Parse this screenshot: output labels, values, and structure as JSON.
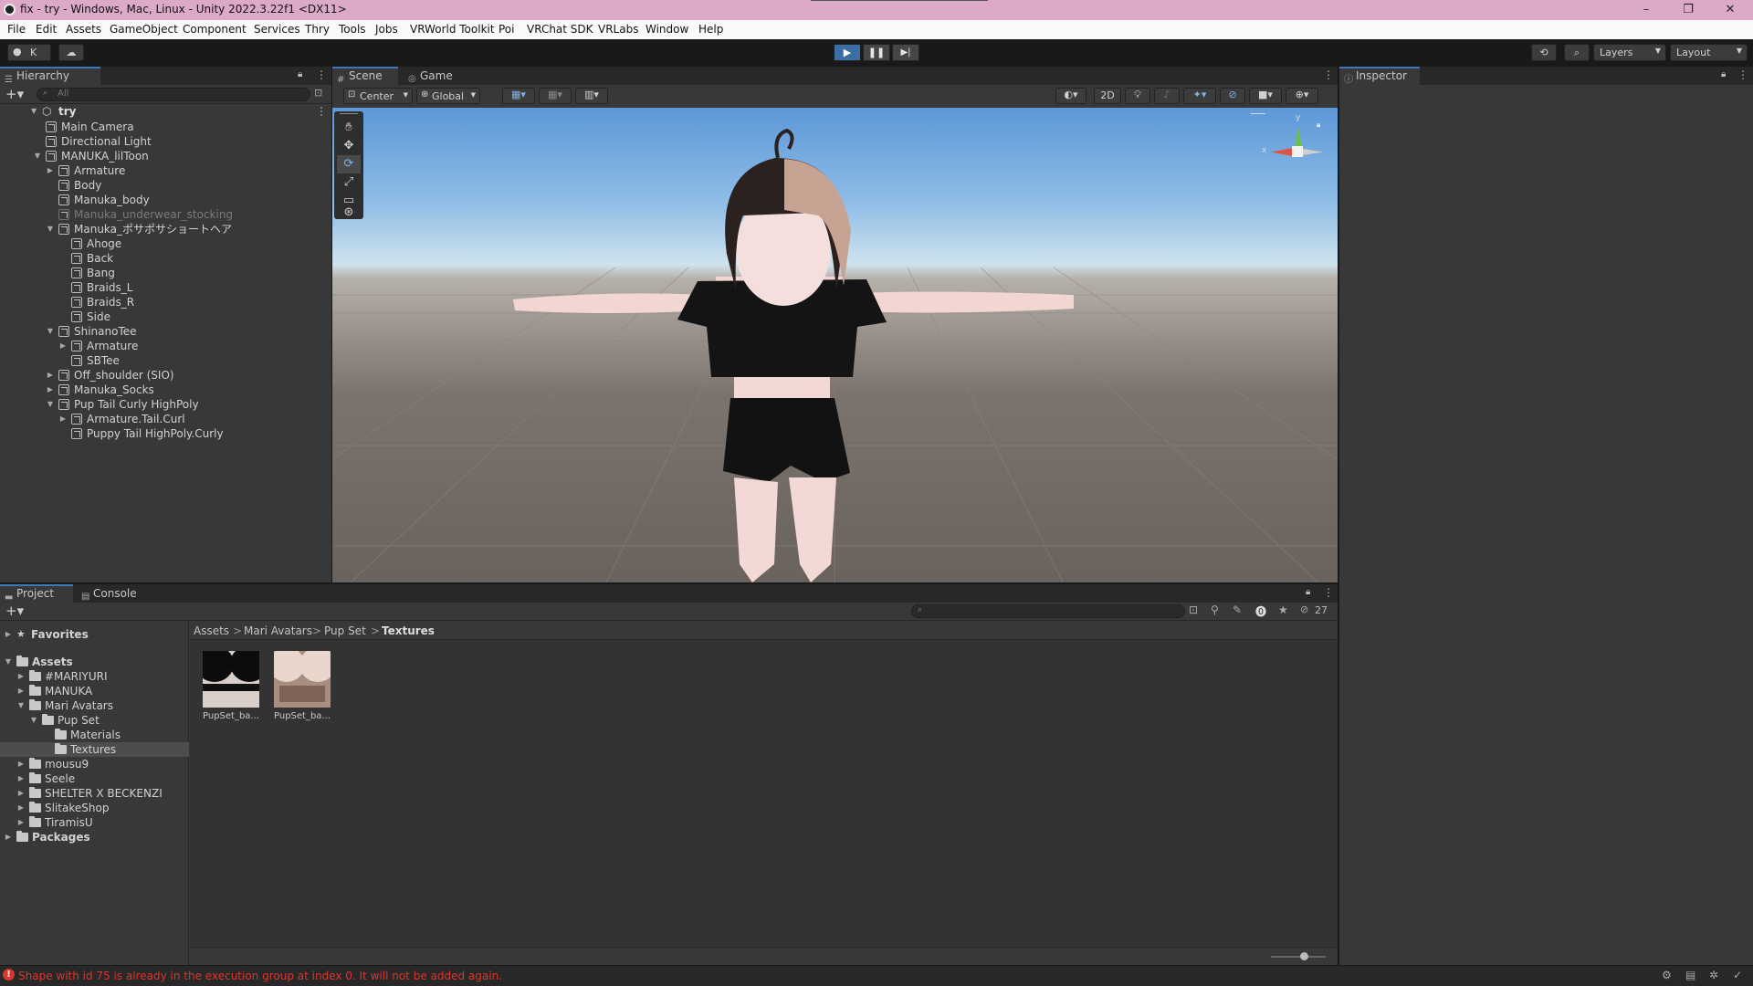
{
  "window": {
    "title": "fix - try - Windows, Mac, Linux - Unity 2022.3.22f1 <DX11>",
    "minimize": "–",
    "maximize": "❐",
    "close": "✕"
  },
  "menu": [
    "File",
    "Edit",
    "Assets",
    "GameObject",
    "Component",
    "Services",
    "Thry",
    "Tools",
    "Jobs",
    "VRWorld Toolkit",
    "Poi",
    "VRChat SDK",
    "VRLabs",
    "Window",
    "Help"
  ],
  "toolbar": {
    "account": "K",
    "play": "▶",
    "pause": "❚❚",
    "step": "▶|",
    "layers": "Layers",
    "layout": "Layout"
  },
  "hierarchy": {
    "tab": "Hierarchy",
    "search_placeholder": "All",
    "scene": "try",
    "items": [
      {
        "label": "Main Camera",
        "depth": 1,
        "fold": ""
      },
      {
        "label": "Directional Light",
        "depth": 1,
        "fold": ""
      },
      {
        "label": "MANUKA_lilToon",
        "depth": 1,
        "fold": "▼"
      },
      {
        "label": "Armature",
        "depth": 2,
        "fold": "▶"
      },
      {
        "label": "Body",
        "depth": 2,
        "fold": ""
      },
      {
        "label": "Manuka_body",
        "depth": 2,
        "fold": ""
      },
      {
        "label": "Manuka_underwear_stocking",
        "depth": 2,
        "fold": "",
        "dim": true
      },
      {
        "label": "Manuka_ポサポサショートヘア",
        "depth": 2,
        "fold": "▼"
      },
      {
        "label": "Ahoge",
        "depth": 3,
        "fold": ""
      },
      {
        "label": "Back",
        "depth": 3,
        "fold": ""
      },
      {
        "label": "Bang",
        "depth": 3,
        "fold": ""
      },
      {
        "label": "Braids_L",
        "depth": 3,
        "fold": ""
      },
      {
        "label": "Braids_R",
        "depth": 3,
        "fold": ""
      },
      {
        "label": "Side",
        "depth": 3,
        "fold": ""
      },
      {
        "label": "ShinanoTee",
        "depth": 2,
        "fold": "▼"
      },
      {
        "label": "Armature",
        "depth": 3,
        "fold": "▶"
      },
      {
        "label": "SBTee",
        "depth": 3,
        "fold": ""
      },
      {
        "label": "Off_shoulder (SIO)",
        "depth": 2,
        "fold": "▶"
      },
      {
        "label": "Manuka_Socks",
        "depth": 2,
        "fold": "▶"
      },
      {
        "label": "Pup Tail Curly HighPoly",
        "depth": 2,
        "fold": "▼"
      },
      {
        "label": "Armature.Tail.Curl",
        "depth": 3,
        "fold": "▶"
      },
      {
        "label": "Puppy Tail HighPoly.Curly",
        "depth": 3,
        "fold": ""
      }
    ]
  },
  "scene_view": {
    "tab_scene": "Scene",
    "tab_game": "Game",
    "pivot": "Center",
    "space": "Global",
    "mode_2d": "2D",
    "gizmo_y": "y",
    "gizmo_x": "x"
  },
  "inspector": {
    "tab": "Inspector"
  },
  "project": {
    "tab_project": "Project",
    "tab_console": "Console",
    "favorites": "Favorites",
    "tree": [
      {
        "label": "Assets",
        "depth": 0,
        "fold": "▼",
        "bold": true
      },
      {
        "label": "#MARIYURI",
        "depth": 1,
        "fold": "▶"
      },
      {
        "label": "MANUKA",
        "depth": 1,
        "fold": "▶"
      },
      {
        "label": "Mari Avatars",
        "depth": 1,
        "fold": "▼"
      },
      {
        "label": "Pup Set",
        "depth": 2,
        "fold": "▼"
      },
      {
        "label": "Materials",
        "depth": 3,
        "fold": ""
      },
      {
        "label": "Textures",
        "depth": 3,
        "fold": "",
        "selected": true
      },
      {
        "label": "mousu9",
        "depth": 1,
        "fold": "▶"
      },
      {
        "label": "Seele",
        "depth": 1,
        "fold": "▶"
      },
      {
        "label": "SHELTER X BECKENZI",
        "depth": 1,
        "fold": "▶"
      },
      {
        "label": "SlitakeShop",
        "depth": 1,
        "fold": "▶"
      },
      {
        "label": "TiramisU",
        "depth": 1,
        "fold": "▶"
      },
      {
        "label": "Packages",
        "depth": 0,
        "fold": "▶",
        "bold": true
      }
    ],
    "breadcrumb": [
      "Assets",
      "Mari Avatars",
      "Pup Set",
      "Textures"
    ],
    "breadcrumb_sep": ">",
    "hidden_count": "27",
    "files": [
      {
        "label": "PupSet_ba..."
      },
      {
        "label": "PupSet_ba..."
      }
    ]
  },
  "status": {
    "message": "Shape with id 75 is already in the execution group at index 0. It will not be added again."
  }
}
